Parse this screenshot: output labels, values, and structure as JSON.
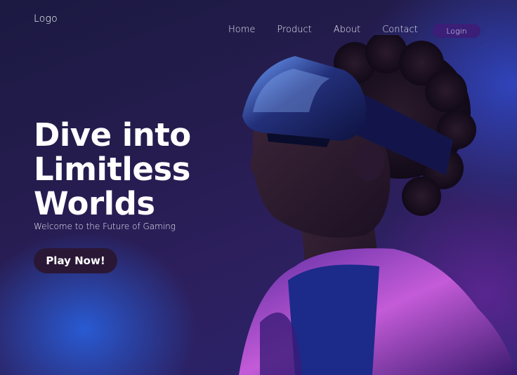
{
  "header": {
    "logo": "Logo",
    "nav": [
      "Home",
      "Product",
      "About",
      "Contact"
    ],
    "login_label": "Login"
  },
  "hero": {
    "title_lines": [
      "Dive into",
      "Limitless",
      "Worlds"
    ],
    "subtitle": "Welcome to the Future of Gaming",
    "cta_label": "Play Now!"
  },
  "colors": {
    "background_dark": "#1b1a42",
    "accent_blue": "#2864e6",
    "accent_purple": "#7828aa",
    "login_button": "#3a1e78",
    "cta_button": "#2a1736"
  },
  "image": {
    "icon": "vr-headset-person-photo"
  }
}
